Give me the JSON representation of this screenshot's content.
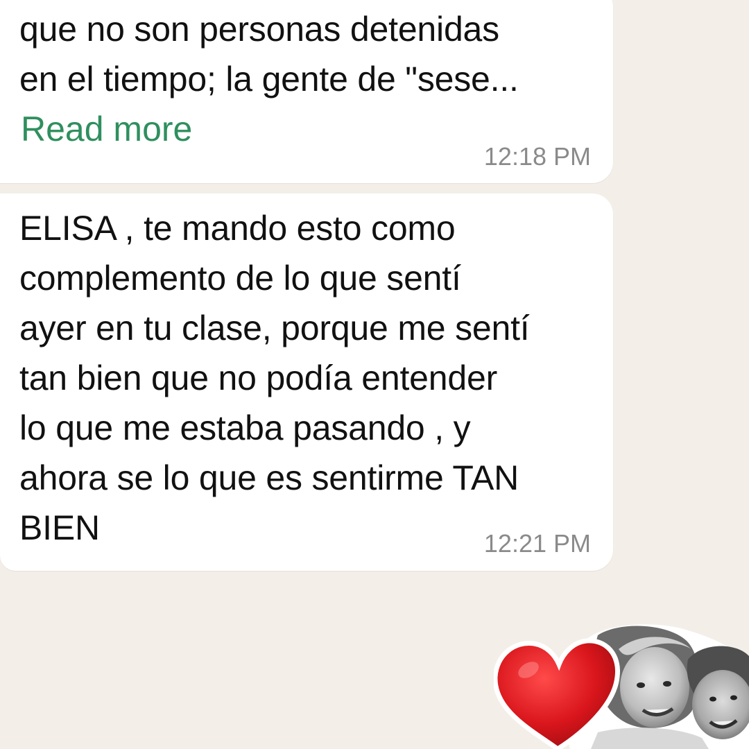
{
  "messages": [
    {
      "text": "que no son personas detenidas\nen el tiempo; la gente de \"sese...",
      "read_more_label": "Read more",
      "time": "12:18 PM"
    },
    {
      "text": "ELISA , te mando esto como\ncomplemento de lo que sentí\nayer en tu clase, porque me sentí\ntan bien que no podía entender\nlo que me estaba pasando , y\nahora se lo que es sentirme TAN\nBIEN",
      "time": "12:21 PM"
    }
  ],
  "sticker": {
    "icon": "heart-icon",
    "heart_color": "#d9161c",
    "depiction": "black-and-white photo of two smiling children with a red heart"
  },
  "colors": {
    "background": "#f3eee8",
    "bubble": "#ffffff",
    "link": "#2f8f5e",
    "timestamp": "#8a8a8a"
  }
}
